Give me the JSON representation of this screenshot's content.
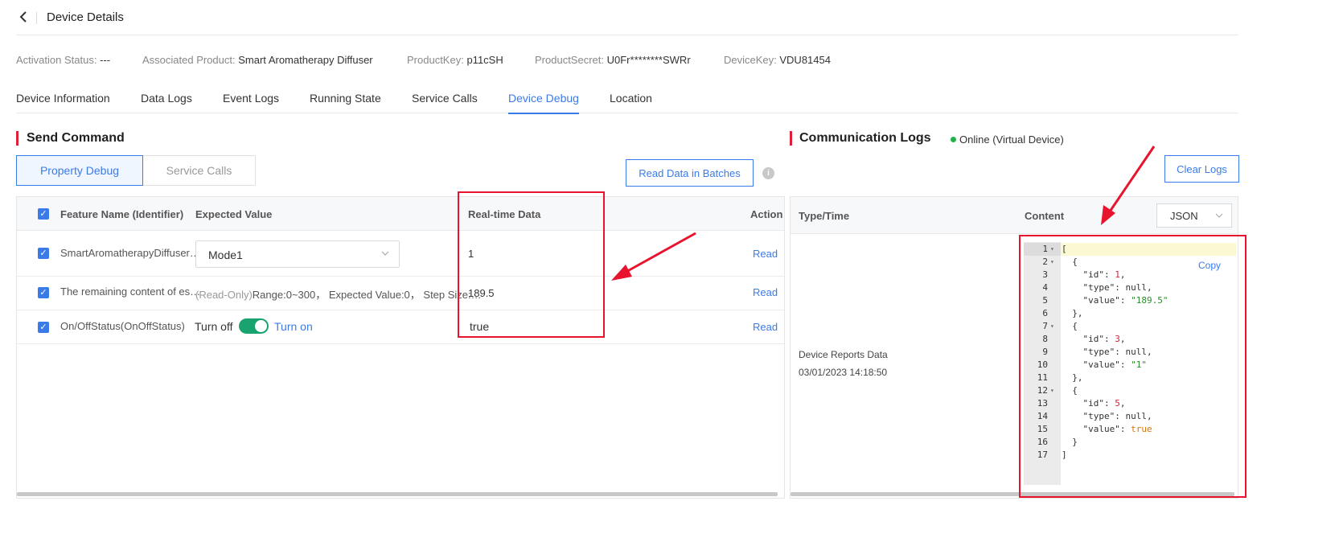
{
  "header": {
    "title": "Device Details"
  },
  "meta": [
    {
      "key": "Activation Status:",
      "value": "---"
    },
    {
      "key": "Associated Product:",
      "value": "Smart Aromatherapy Diffuser"
    },
    {
      "key": "ProductKey:",
      "value": "p11cSH"
    },
    {
      "key": "ProductSecret:",
      "value": "U0Fr********SWRr"
    },
    {
      "key": "DeviceKey:",
      "value": "VDU81454"
    }
  ],
  "tabs": [
    "Device Information",
    "Data Logs",
    "Event Logs",
    "Running State",
    "Service Calls",
    "Device Debug",
    "Location"
  ],
  "active_tab": "Device Debug",
  "send_command": {
    "title": "Send Command",
    "seg_property_debug": "Property Debug",
    "seg_service_calls": "Service Calls",
    "read_batch_label": "Read Data in Batches",
    "info_glyph": "i",
    "columns": {
      "feature": "Feature Name (Identifier)",
      "expected": "Expected Value",
      "realtime": "Real-time Data",
      "action": "Action"
    },
    "rows": [
      {
        "feature": "SmartAromatherapyDiffuser…",
        "select_value": "Mode1",
        "realtime": "1",
        "action": "Read"
      },
      {
        "feature": "The remaining content of es…",
        "readonly_tag": "(Read-Only)",
        "range_text": "Range:0~300，  Expected Value:0，  Step Size:…",
        "realtime": "189.5",
        "action": "Read"
      },
      {
        "feature": "On/OffStatus(OnOffStatus)",
        "toggle_off": "Turn off",
        "toggle_on": "Turn on",
        "toggle_state": true,
        "realtime": "true",
        "action": "Read"
      }
    ]
  },
  "comm_logs": {
    "title": "Communication Logs",
    "status": "Online (Virtual Device)",
    "clear_label": "Clear Logs",
    "col_type_time": "Type/Time",
    "col_content": "Content",
    "format_value": "JSON",
    "entry_type": "Device Reports Data",
    "entry_time": "03/01/2023 14:18:50",
    "copy_label": "Copy",
    "code_lines": [
      "[",
      "  {",
      "    \"id\": 1,",
      "    \"type\": null,",
      "    \"value\": \"189.5\"",
      "  },",
      "  {",
      "    \"id\": 3,",
      "    \"type\": null,",
      "    \"value\": \"1\"",
      "  },",
      "  {",
      "    \"id\": 5,",
      "    \"type\": null,",
      "    \"value\": true",
      "  }",
      "]"
    ]
  },
  "colors": {
    "accent": "#3b7be8",
    "annotation_red": "#e8132c",
    "toggle_on": "#1aa36f",
    "online": "#21b34a"
  },
  "icons": [
    "back-chevron-icon",
    "info-icon",
    "chevron-down-icon",
    "check-icon",
    "fold-arrow-icon",
    "annotation-arrow"
  ]
}
